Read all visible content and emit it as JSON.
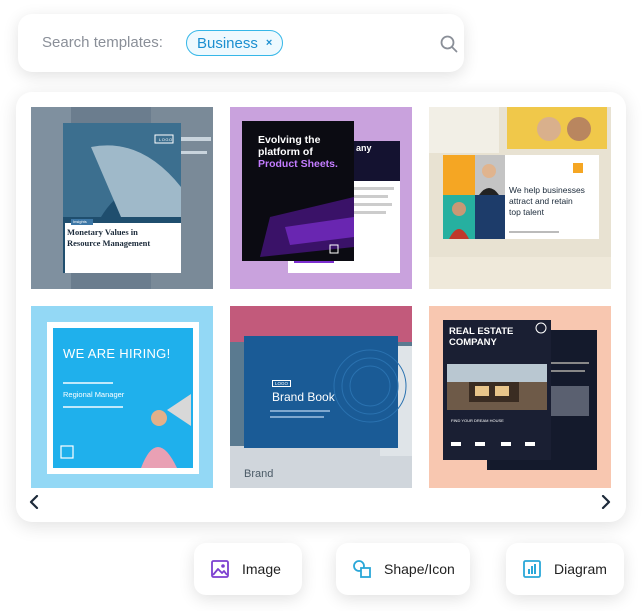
{
  "search": {
    "label": "Search templates:",
    "chip_label": "Business",
    "chip_remove": "×",
    "icon": "search-icon"
  },
  "colors": {
    "accent": "#36b7e8",
    "button_icon": "#2aa7d8",
    "image_icon": "#7c3fd0"
  },
  "templates": [
    {
      "title": "Monetary Values in Resource Management",
      "logo": "LOGO",
      "tag": "Insights"
    },
    {
      "title_line1": "Evolving the",
      "title_line2": "platform of",
      "title_highlight": "Product Sheets.",
      "side_text": "any"
    },
    {
      "headline_line1": "We help businesses",
      "headline_line2": "attract and retain",
      "headline_line3": "top talent"
    },
    {
      "headline": "WE ARE HIRING!",
      "subtitle": "Regional Manager"
    },
    {
      "logo": "LOGO",
      "title": "Brand Book",
      "back_text": "Brand"
    },
    {
      "title_line1": "REAL ESTATE",
      "title_line2": "COMPANY",
      "caption": "FIND YOUR DREAM HOUSE"
    }
  ],
  "nav": {
    "prev": "‹",
    "next": "›"
  },
  "buttons": [
    {
      "label": "Image",
      "icon": "image-icon"
    },
    {
      "label": "Shape/Icon",
      "icon": "shape-icon"
    },
    {
      "label": "Diagram",
      "icon": "bar-chart-icon"
    }
  ]
}
